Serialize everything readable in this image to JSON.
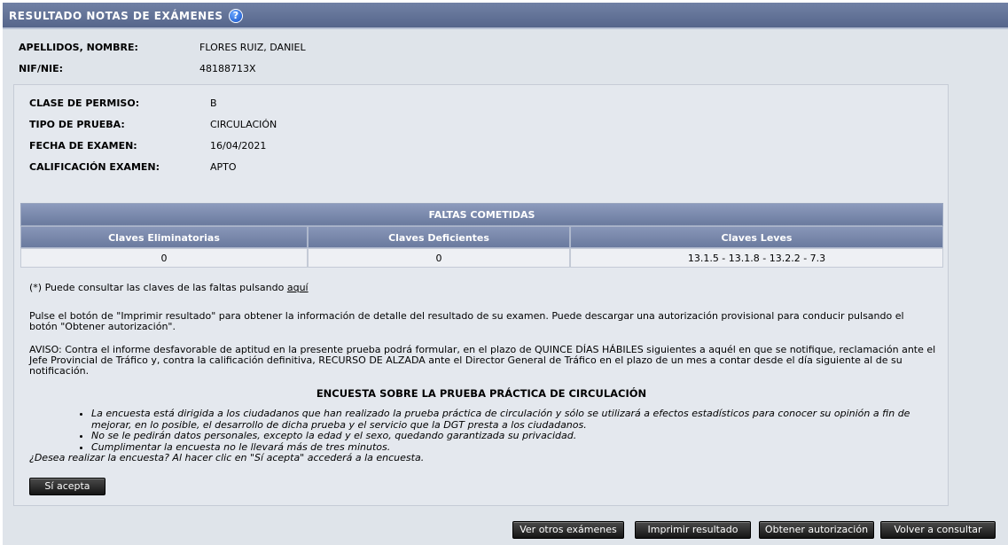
{
  "header": {
    "title": "RESULTADO NOTAS DE EXÁMENES",
    "help_icon": "?"
  },
  "person": {
    "name_label": "APELLIDOS, NOMBRE:",
    "name_value": "FLORES RUIZ, DANIEL",
    "nif_label": "NIF/NIE:",
    "nif_value": "48188713X"
  },
  "exam": {
    "permiso_label": "CLASE DE PERMISO:",
    "permiso_value": "B",
    "prueba_label": "TIPO DE PRUEBA:",
    "prueba_value": "CIRCULACIÓN",
    "fecha_label": "FECHA DE EXAMEN:",
    "fecha_value": "16/04/2021",
    "calificacion_label": "CALIFICACIÓN EXAMEN:",
    "calificacion_value": "APTO"
  },
  "faltas": {
    "title": "FALTAS COMETIDAS",
    "columns": [
      "Claves Eliminatorias",
      "Claves Deficientes",
      "Claves Leves"
    ],
    "values": [
      "0",
      "0",
      "13.1.5 - 13.1.8 - 13.2.2 - 7.3"
    ]
  },
  "notes": {
    "consult_prefix": "(*) Puede consultar las claves de las faltas pulsando ",
    "consult_link": "aquí",
    "print_info": "Pulse el botón de \"Imprimir resultado\" para obtener la información de detalle del resultado de su examen. Puede descargar una autorización provisional para conducir pulsando el botón \"Obtener autorización\".",
    "aviso": "AVISO: Contra el informe desfavorable de aptitud en la presente prueba podrá formular, en el plazo de QUINCE DÍAS HÁBILES siguientes a aquél en que se notifique, reclamación ante el Jefe Provincial de Tráfico y, contra la calificación definitiva, RECURSO DE ALZADA ante el Director General de Tráfico en el plazo de un mes a contar desde el día siguiente al de su notificación."
  },
  "survey": {
    "title": "ENCUESTA SOBRE LA PRUEBA PRÁCTICA DE CIRCULACIÓN",
    "items": [
      "La encuesta está dirigida a los ciudadanos que han realizado la prueba práctica de circulación y sólo se utilizará a efectos estadísticos para conocer su opinión a fin de mejorar, en lo posible, el desarrollo de dicha prueba y el servicio que la DGT presta a los ciudadanos.",
      "No se le pedirán datos personales, excepto la edad y el sexo, quedando garantizada su privacidad.",
      "Cumplimentar la encuesta no le llevará más de tres minutos."
    ],
    "question": "¿Desea realizar la encuesta? Al hacer clic en \"Sí acepta\" accederá a la encuesta.",
    "accept_button": "Sí acepta"
  },
  "actions": {
    "otros": "Ver otros exámenes",
    "imprimir": "Imprimir resultado",
    "autorizacion": "Obtener autorización",
    "volver": "Volver a consultar"
  }
}
